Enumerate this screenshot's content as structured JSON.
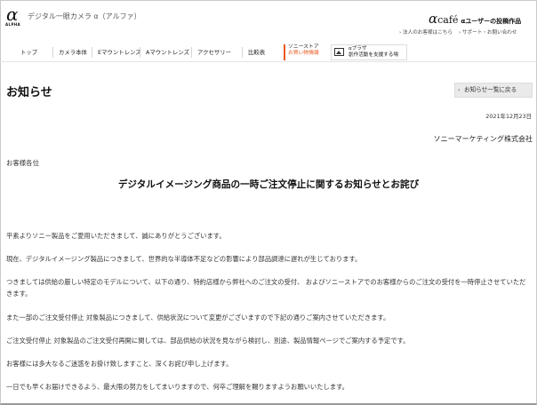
{
  "header": {
    "logo_mark": "α",
    "logo_sub": "ALPHA",
    "site_title": "デジタル一眼カメラ α（アルファ）",
    "cafe_alpha": "α",
    "cafe_word": "café",
    "cafe_tag": "αユーザーの投稿作品",
    "sub_links": [
      "› 法人のお客様はこちら",
      "› サポート・お問い合わせ"
    ]
  },
  "nav": {
    "items": [
      "トップ",
      "カメラ本体",
      "Eマウントレンズ",
      "Aマウントレンズ",
      "アクセサリー",
      "比較表"
    ],
    "store_line1": "ソニーストア",
    "store_line2": "お買い物情報",
    "plaza_line1": "αプラザ",
    "plaza_line2": "創作活動を支援する場"
  },
  "page": {
    "title": "お知らせ",
    "back_label": "お知らせ一覧に戻る",
    "back_arrow": "›",
    "date": "2021年12月23日",
    "company": "ソニーマーケティング株式会社",
    "salutation": "お客様各位",
    "notice_title": "デジタルイメージング商品の一時ご注文停止に関するお知らせとお詫び",
    "paragraphs": [
      "平素よりソニー製品をご愛用いただきまして、誠にありがとうございます。",
      "現在、デジタルイメージング製品につきまして、世界的な半導体不足などの影響により部品調達に遅れが生じております。",
      "つきましては供給の厳しい特定のモデルについて、以下の通り、特約店様から弊社へのご注文の受付、 およびソニーストアでのお客様からのご注文の受付を一時停止させていただきます。",
      "また一部のご注文受付停止 対象製品につきまして、供給状況について変更がございますので下記の通りご案内させていただきます。",
      "ご注文受付停止 対象製品のご注文受付再開に関しては、部品供給の状況を見ながら検討し、別途、製品情報ページでご案内する予定です。",
      "お客様には多大なるご迷惑をお掛け致しますこと、深くお詫び申し上げます。",
      "一日でも早くお届けできるよう、最大限の努力をしてまいりますので、何卒ご理解を賜りますようお願いいたします。"
    ]
  }
}
